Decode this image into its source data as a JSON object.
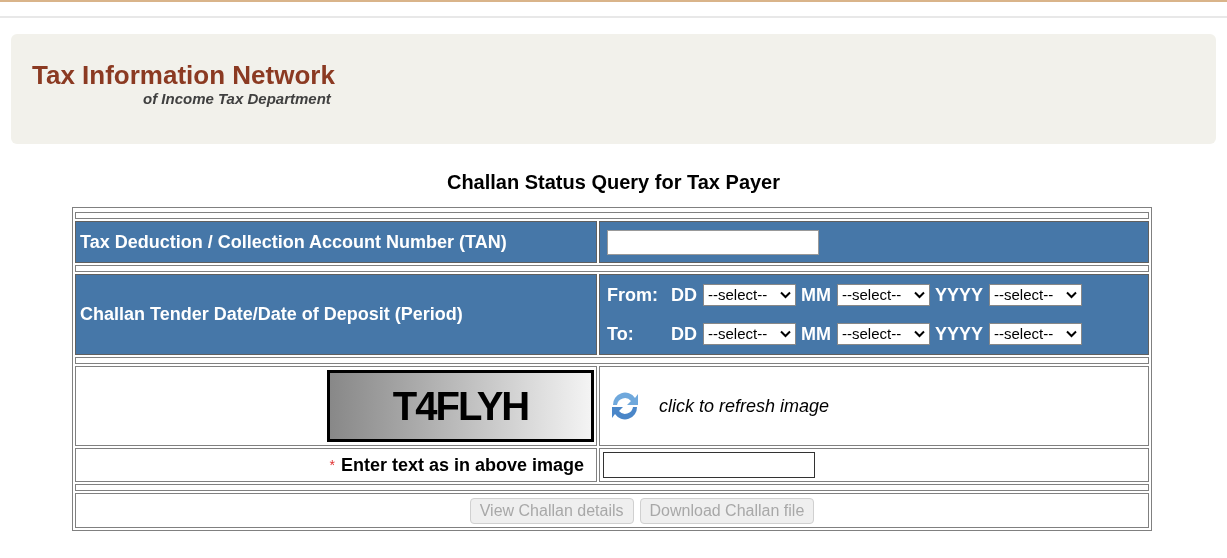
{
  "header": {
    "title": "Tax Information Network",
    "subtitle": "of Income Tax Department"
  },
  "page_title": "Challan Status Query for Tax Payer",
  "tan": {
    "label": "Tax Deduction / Collection Account Number (TAN)"
  },
  "period": {
    "label": "Challan Tender Date/Date of Deposit (Period)",
    "rows": [
      {
        "label": "From:",
        "fields": [
          {
            "label": "DD",
            "value": "--select--"
          },
          {
            "label": "MM",
            "value": "--select--"
          },
          {
            "label": "YYYY",
            "value": "--select--"
          }
        ]
      },
      {
        "label": "To:",
        "fields": [
          {
            "label": "DD",
            "value": "--select--"
          },
          {
            "label": "MM",
            "value": "--select--"
          },
          {
            "label": "YYYY",
            "value": "--select--"
          }
        ]
      }
    ]
  },
  "captcha": {
    "text": "T4FLYH",
    "refresh_label": "click to refresh image"
  },
  "captcha_input": {
    "required_mark": "*",
    "label": "Enter text as in above image"
  },
  "buttons": [
    {
      "label": "View Challan details",
      "disabled": true
    },
    {
      "label": "Download Challan file",
      "disabled": true
    }
  ]
}
